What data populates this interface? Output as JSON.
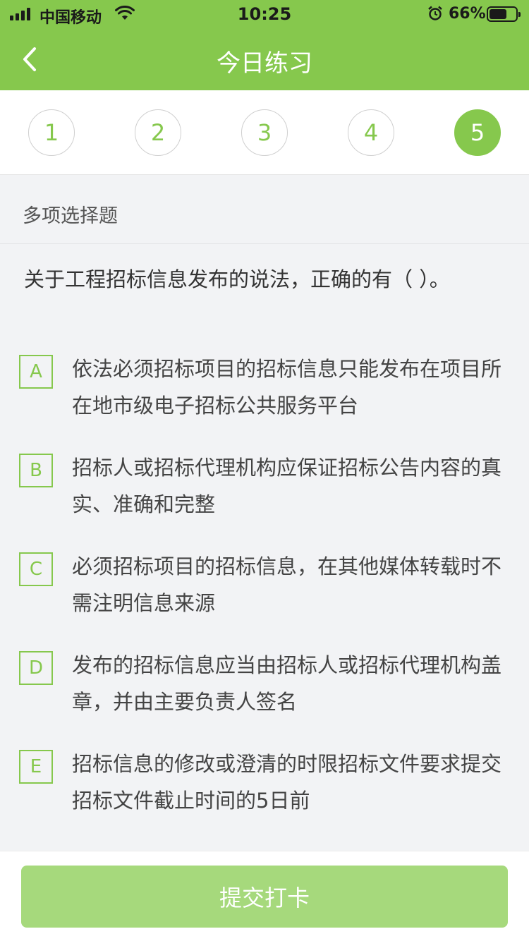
{
  "status_bar": {
    "carrier": "中国移动",
    "time": "10:25",
    "battery_percent": "66%",
    "battery_level": 0.66,
    "icons": [
      "signal-icon",
      "wifi-icon",
      "alarm-icon",
      "battery-icon"
    ]
  },
  "header": {
    "title": "今日练习",
    "back_icon": "chevron-left-icon",
    "color": "#86c84d"
  },
  "tabs": {
    "items": [
      "1",
      "2",
      "3",
      "4",
      "5"
    ],
    "active_index": 4
  },
  "question": {
    "type_label": "多项选择题",
    "text": "关于工程招标信息发布的说法，正确的有（ ）。",
    "options": [
      {
        "letter": "A",
        "text": "依法必须招标项目的招标信息只能发布在项目所在地市级电子招标公共服务平台"
      },
      {
        "letter": "B",
        "text": "招标人或招标代理机构应保证招标公告内容的真实、准确和完整"
      },
      {
        "letter": "C",
        "text": "必须招标项目的招标信息，在其他媒体转载时不需注明信息来源"
      },
      {
        "letter": "D",
        "text": "发布的招标信息应当由招标人或招标代理机构盖章，并由主要负责人签名"
      },
      {
        "letter": "E",
        "text": "招标信息的修改或澄清的时限招标文件要求提交招标文件截止时间的5日前"
      }
    ]
  },
  "footer": {
    "submit_label": "提交打卡",
    "button_color": "#a6d97c"
  }
}
